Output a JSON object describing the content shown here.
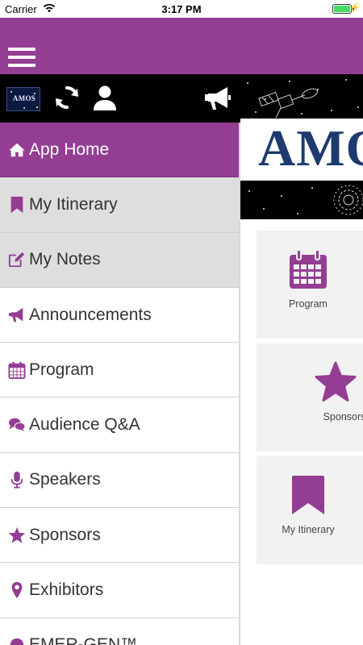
{
  "status_bar": {
    "carrier": "Carrier",
    "time": "3:17 PM",
    "battery_level": 1.0,
    "charging": true
  },
  "app_bar": {
    "menu_icon": "hamburger-menu-icon",
    "background_color": "#933e93"
  },
  "toolbar": {
    "logo_text": "AMOS",
    "icons": [
      "sync-icon",
      "user-icon",
      "megaphone-icon"
    ]
  },
  "banner": {
    "logo_text": "AMO"
  },
  "drawer": {
    "items": [
      {
        "label": "App Home",
        "icon": "home-icon",
        "state": "active"
      },
      {
        "label": "My Itinerary",
        "icon": "bookmark-icon",
        "state": "shaded"
      },
      {
        "label": "My Notes",
        "icon": "edit-icon",
        "state": "shaded"
      },
      {
        "label": "Announcements",
        "icon": "megaphone-icon",
        "state": "normal"
      },
      {
        "label": "Program",
        "icon": "calendar-icon",
        "state": "normal"
      },
      {
        "label": "Audience Q&A",
        "icon": "comments-icon",
        "state": "normal"
      },
      {
        "label": "Speakers",
        "icon": "microphone-icon",
        "state": "normal"
      },
      {
        "label": "Sponsors",
        "icon": "star-icon",
        "state": "normal"
      },
      {
        "label": "Exhibitors",
        "icon": "map-marker-icon",
        "state": "normal"
      },
      {
        "label": "EMER-GEN™",
        "icon": "generic-icon",
        "state": "normal"
      }
    ]
  },
  "cards": [
    {
      "label": "Program",
      "icon": "calendar-icon"
    },
    {
      "label": "Sponsors",
      "icon": "star-icon"
    },
    {
      "label": "My Itinerary",
      "icon": "bookmark-icon"
    }
  ],
  "colors": {
    "accent": "#933e93",
    "drawer_shaded": "#dedede",
    "card_bg": "#f2f2f2",
    "banner_logo": "#1e3a6e"
  }
}
